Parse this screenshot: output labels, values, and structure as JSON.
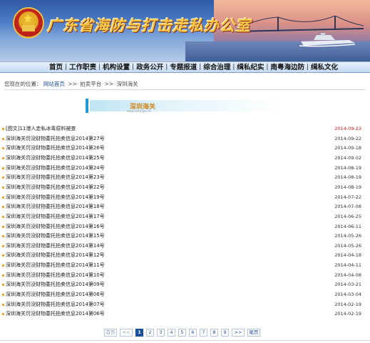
{
  "header": {
    "site_title": "广东省海防与打击走私办公室",
    "emblem_icon": "national-emblem-icon"
  },
  "nav": {
    "items": [
      "首页",
      "工作职责",
      "机构设置",
      "政务公开",
      "专题报道",
      "综合治理",
      "缉私纪实",
      "南粤海边防",
      "缉私文化"
    ],
    "separator": "|"
  },
  "breadcrumb": {
    "label": "您现在的位置：",
    "items": [
      "网站首页",
      "拍卖平台",
      "深圳海关"
    ],
    "separator": ">>"
  },
  "section": {
    "title": "深圳海关",
    "subtitle": "www.szhg.gov.cn"
  },
  "colors": {
    "nav_bg": "#c4d9f1",
    "accent_blue": "#1a4f9c",
    "hot_date": "#d0141b",
    "bullet": "#e7a630"
  },
  "list": [
    {
      "title": "[图文]11港人走私冰毒原料被查",
      "date": "2014-09-23",
      "hot": true
    },
    {
      "title": "深圳海关罚没财物委托拍卖信息2014第27号",
      "date": "2014-09-22",
      "hot": false
    },
    {
      "title": "深圳海关罚没财物委托拍卖信息2014第26号",
      "date": "2014-09-18",
      "hot": false
    },
    {
      "title": "深圳海关罚没财物委托拍卖信息2014第25号",
      "date": "2014-09-02",
      "hot": false
    },
    {
      "title": "深圳海关罚没财物委托拍卖信息2014第24号",
      "date": "2014-08-19",
      "hot": false
    },
    {
      "title": "深圳海关罚没财物委托拍卖信息2014第23号",
      "date": "2014-08-19",
      "hot": false
    },
    {
      "title": "深圳海关罚没财物委托拍卖信息2014第22号",
      "date": "2014-08-19",
      "hot": false
    },
    {
      "title": "深圳海关罚没财物委托拍卖信息2014第19号",
      "date": "2014-07-22",
      "hot": false
    },
    {
      "title": "深圳海关罚没财物委托拍卖信息2014第18号",
      "date": "2014-07-08",
      "hot": false
    },
    {
      "title": "深圳海关罚没财物委托拍卖信息2014第17号",
      "date": "2014-06-25",
      "hot": false
    },
    {
      "title": "深圳海关罚没财物委托拍卖信息2014第16号",
      "date": "2014-06-11",
      "hot": false
    },
    {
      "title": "深圳海关罚没财物委托拍卖信息2014第15号",
      "date": "2014-05-26",
      "hot": false
    },
    {
      "title": "深圳海关罚没财物委托拍卖信息2014第14号",
      "date": "2014-05-26",
      "hot": false
    },
    {
      "title": "深圳海关罚没财物委托拍卖信息2014第12号",
      "date": "2014-04-18",
      "hot": false
    },
    {
      "title": "深圳海关罚没财物委托拍卖信息2014第11号",
      "date": "2014-04-11",
      "hot": false
    },
    {
      "title": "深圳海关罚没财物委托拍卖信息2014第10号",
      "date": "2014-04-08",
      "hot": false
    },
    {
      "title": "深圳海关罚没财物委托拍卖信息2014第09号",
      "date": "2014-03-21",
      "hot": false
    },
    {
      "title": "深圳海关罚没财物委托拍卖信息2014第08号",
      "date": "2014-03-04",
      "hot": false
    },
    {
      "title": "深圳海关罚没财物委托拍卖信息2014第07号",
      "date": "2014-02-19",
      "hot": false
    },
    {
      "title": "深圳海关罚没财物委托拍卖信息2014第06号",
      "date": "2014-02-19",
      "hot": false
    }
  ],
  "pager": {
    "first": "首页",
    "prev": "<<",
    "pages": [
      "1",
      "2",
      "3",
      "4",
      "5",
      "6",
      "7",
      "8",
      "9"
    ],
    "current": "1",
    "next_arrow": ">>",
    "last": "尾页"
  }
}
